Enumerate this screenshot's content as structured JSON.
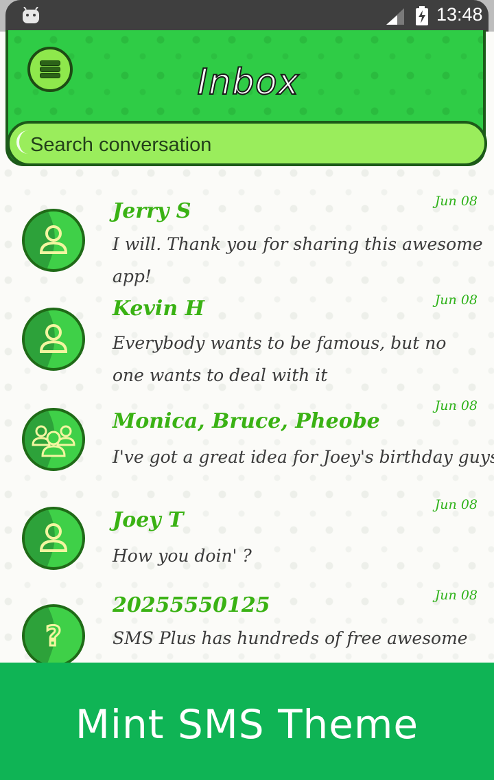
{
  "status_bar": {
    "time": "13:48"
  },
  "header": {
    "title": "Inbox"
  },
  "search": {
    "placeholder": "Search conversation"
  },
  "conversations": [
    {
      "name": "Jerry S",
      "date": "Jun 08",
      "preview": "I will. Thank you for sharing this awesome app!",
      "avatar": "single-person-icon"
    },
    {
      "name": "Kevin H",
      "date": "Jun 08",
      "preview": "Everybody wants to be famous, but no one wants to deal with it",
      "avatar": "single-person-icon"
    },
    {
      "name": "Monica, Bruce, Pheobe",
      "date": "Jun 08",
      "preview": "I've got a great idea for Joey's birthday guys!",
      "avatar": "group-icon"
    },
    {
      "name": "Joey T",
      "date": "Jun 08",
      "preview": "How you doin' ?",
      "avatar": "single-person-icon"
    },
    {
      "name": "20255550125",
      "date": "Jun 08",
      "preview": "SMS Plus has hundreds of free awesome",
      "avatar": "unknown-contact-icon"
    }
  ],
  "banner": {
    "text": "Mint SMS Theme"
  }
}
